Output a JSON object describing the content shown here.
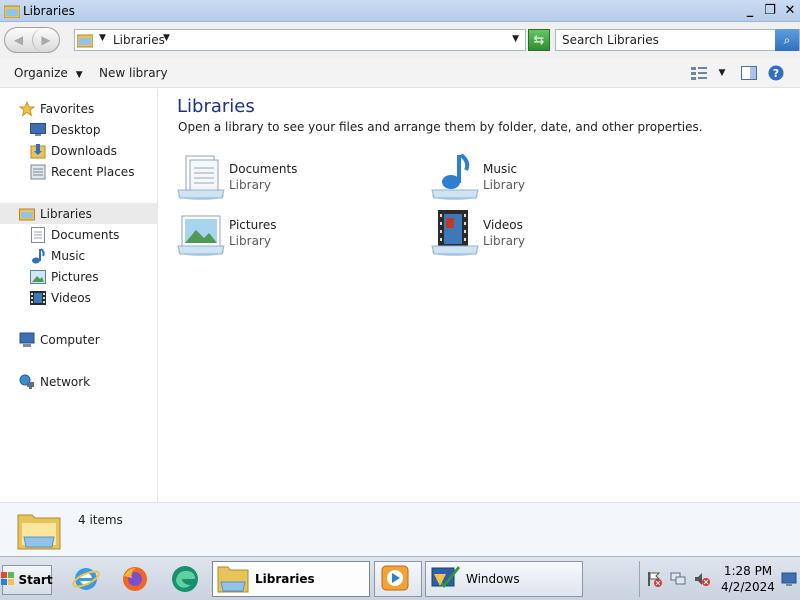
{
  "window": {
    "title": "Libraries",
    "controls": {
      "minimize": "_",
      "restore": "❐",
      "close": "✕"
    }
  },
  "address": {
    "crumb": "Libraries",
    "search_placeholder": "Search Libraries"
  },
  "toolbar": {
    "organize": "Organize",
    "new_library": "New library"
  },
  "sidebar": {
    "favorites": {
      "label": "Favorites",
      "items": [
        {
          "label": "Desktop",
          "icon": "desktop-icon"
        },
        {
          "label": "Downloads",
          "icon": "downloads-icon"
        },
        {
          "label": "Recent Places",
          "icon": "recent-places-icon"
        }
      ]
    },
    "libraries": {
      "label": "Libraries",
      "items": [
        {
          "label": "Documents",
          "icon": "documents-icon"
        },
        {
          "label": "Music",
          "icon": "music-icon"
        },
        {
          "label": "Pictures",
          "icon": "pictures-icon"
        },
        {
          "label": "Videos",
          "icon": "videos-icon"
        }
      ]
    },
    "computer": {
      "label": "Computer"
    },
    "network": {
      "label": "Network"
    }
  },
  "main": {
    "heading": "Libraries",
    "subtitle": "Open a library to see your files and arrange them by folder, date, and other properties.",
    "libraries": [
      {
        "name": "Documents",
        "type": "Library",
        "icon": "documents-library-icon"
      },
      {
        "name": "Music",
        "type": "Library",
        "icon": "music-library-icon"
      },
      {
        "name": "Pictures",
        "type": "Library",
        "icon": "pictures-library-icon"
      },
      {
        "name": "Videos",
        "type": "Library",
        "icon": "videos-library-icon"
      }
    ]
  },
  "details": {
    "count": "4 items"
  },
  "taskbar": {
    "start": "Start",
    "tasks": [
      {
        "label": "Libraries",
        "active": true
      },
      {
        "label": "",
        "active": false
      },
      {
        "label": "Windows",
        "active": false
      }
    ],
    "clock": {
      "time": "1:28 PM",
      "date": "4/2/2024"
    }
  },
  "colors": {
    "heading": "#1e3287",
    "titlebar": "#c9dcf2",
    "selected_nav": "#eaeaea"
  }
}
